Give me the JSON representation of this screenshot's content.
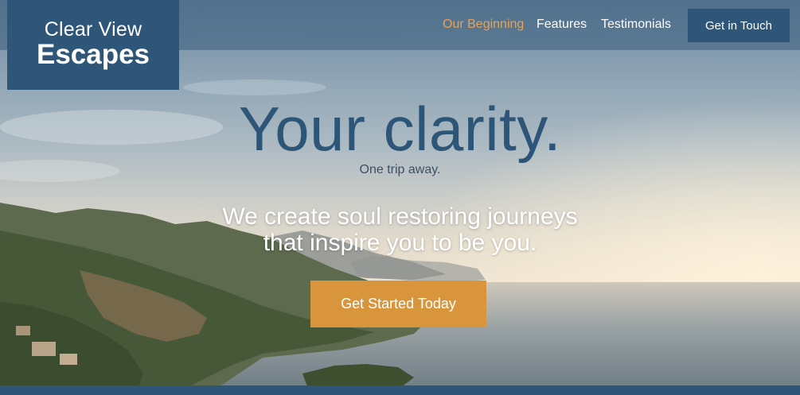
{
  "brand": {
    "line1": "Clear View",
    "line2": "Escapes"
  },
  "nav": {
    "items": [
      {
        "label": "Our Beginning",
        "active": true
      },
      {
        "label": "Features",
        "active": false
      },
      {
        "label": "Testimonials",
        "active": false
      }
    ],
    "cta_label": "Get in Touch"
  },
  "hero": {
    "headline": "Your clarity.",
    "subhead": "One trip away.",
    "tagline_line1": "We create soul restoring journeys",
    "tagline_line2": "that inspire you to be you.",
    "cta_label": "Get Started Today"
  },
  "colors": {
    "brand_blue": "#2f5679",
    "accent_orange": "#d9953c",
    "active_link": "#e9a254"
  }
}
